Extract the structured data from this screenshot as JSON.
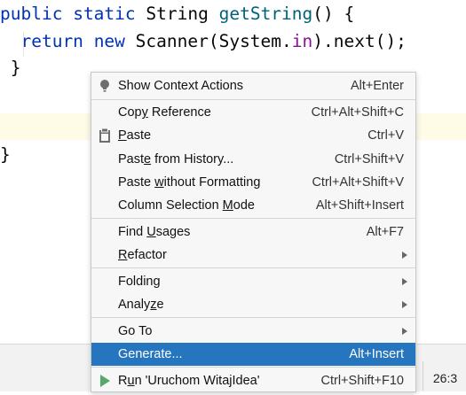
{
  "editor": {
    "line1": {
      "kw1": "public",
      "kw2": "static",
      "type": "String",
      "method": "getString",
      "rest": "() {"
    },
    "line2": {
      "kw1": "return",
      "kw2": "new",
      "pre": "Scanner(System.",
      "field": "in",
      "post": ").next();"
    },
    "line3": "}",
    "line4": "}"
  },
  "menu": {
    "items": [
      {
        "pre": "Show Context Actions",
        "u": "",
        "post": "",
        "shortcut": "Alt+Enter",
        "icon": "bulb-icon"
      },
      {
        "pre": "Cop",
        "u": "y",
        "post": " Reference",
        "shortcut": "Ctrl+Alt+Shift+C"
      },
      {
        "pre": "",
        "u": "P",
        "post": "aste",
        "shortcut": "Ctrl+V",
        "icon": "clipboard-icon"
      },
      {
        "pre": "Past",
        "u": "e",
        "post": " from History...",
        "shortcut": "Ctrl+Shift+V"
      },
      {
        "pre": "Paste ",
        "u": "w",
        "post": "ithout Formatting",
        "shortcut": "Ctrl+Alt+Shift+V"
      },
      {
        "pre": "Column Selection ",
        "u": "M",
        "post": "ode",
        "shortcut": "Alt+Shift+Insert"
      },
      {
        "pre": "Find ",
        "u": "U",
        "post": "sages",
        "shortcut": "Alt+F7"
      },
      {
        "pre": "",
        "u": "R",
        "post": "efactor",
        "shortcut": ""
      },
      {
        "pre": "Folding",
        "u": "",
        "post": "",
        "shortcut": ""
      },
      {
        "pre": "Analy",
        "u": "z",
        "post": "e",
        "shortcut": ""
      },
      {
        "pre": "Go To",
        "u": "",
        "post": "",
        "shortcut": ""
      },
      {
        "pre": "Generate...",
        "u": "",
        "post": "",
        "shortcut": "Alt+Insert"
      },
      {
        "pre": "R",
        "u": "u",
        "post": "n 'Uruchom WitajIdea'",
        "shortcut": "Ctrl+Shift+F10",
        "icon": "run-icon"
      }
    ]
  },
  "status": {
    "position": "26:3"
  },
  "colors": {
    "selection": "#2675bf",
    "keyword": "#0033b3",
    "method": "#00627a",
    "field": "#871094",
    "run_green": "#59a869"
  }
}
